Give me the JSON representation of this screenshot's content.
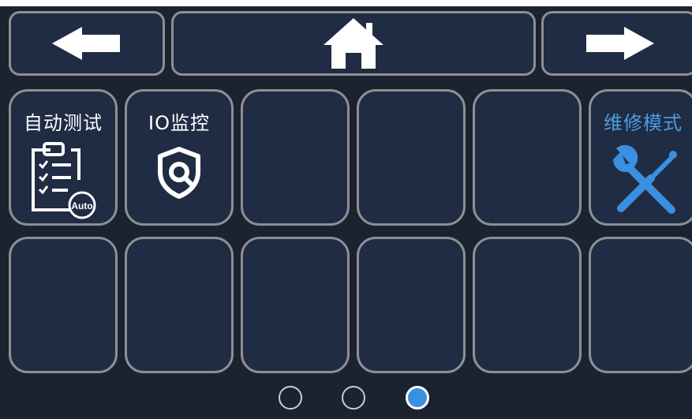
{
  "nav": {
    "back_icon": "arrow-left-icon",
    "home_icon": "home-icon",
    "forward_icon": "arrow-right-icon"
  },
  "tiles": [
    {
      "label": "自动测试",
      "icon": "auto-test-checklist-icon",
      "icon_badge": "Auto"
    },
    {
      "label": "IO监控",
      "icon": "shield-search-icon"
    },
    {
      "label": ""
    },
    {
      "label": ""
    },
    {
      "label": ""
    },
    {
      "label": "维修模式",
      "icon": "wrench-screwdriver-icon",
      "label_color": "#4a9de3"
    },
    {
      "label": ""
    },
    {
      "label": ""
    },
    {
      "label": ""
    },
    {
      "label": ""
    },
    {
      "label": ""
    },
    {
      "label": ""
    }
  ],
  "pagination": {
    "pages": 3,
    "current": 3
  },
  "colors": {
    "background": "#1b2230",
    "tile_fill": "#202c43",
    "tile_border": "#8d8f93",
    "accent": "#3a8fe0",
    "label_accent": "#4a9de3"
  }
}
